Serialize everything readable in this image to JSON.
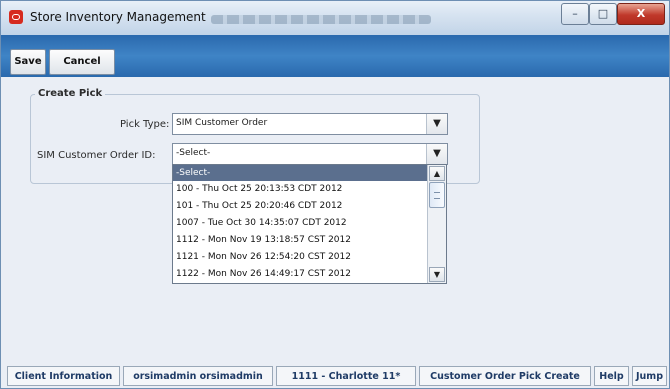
{
  "window": {
    "title": "Store Inventory Management",
    "min_glyph": "–",
    "max_glyph": "□",
    "close_glyph": "X"
  },
  "toolbar": {
    "save_label": "Save",
    "cancel_label": "Cancel"
  },
  "form": {
    "section_title": "Create Pick",
    "pick_type_label": "Pick Type:",
    "pick_type_value": "SIM Customer Order",
    "order_id_label": "SIM Customer Order ID:",
    "order_id_value": "-Select-",
    "dropdown_options": [
      "-Select-",
      "100 - Thu Oct 25 20:13:53 CDT 2012",
      "101 - Thu Oct 25 20:20:46 CDT 2012",
      "1007 - Tue Oct 30 14:35:07 CDT 2012",
      "1112 - Mon Nov 19 13:18:57 CST 2012",
      "1121 - Mon Nov 26 12:54:20 CST 2012",
      "1122 - Mon Nov 26 14:49:17 CST 2012"
    ],
    "selected_option_index": 0
  },
  "status_bar": {
    "items": [
      "Client Information",
      "orsimadmin orsimadmin",
      "1111 - Charlotte 11*",
      "Customer Order Pick Create",
      "Help",
      "Jump"
    ]
  },
  "icons": {
    "combo_arrow": "dropdown-arrow-icon",
    "scroll_up": "scroll-up-icon",
    "scroll_down": "scroll-down-icon"
  },
  "colors": {
    "toolbar": "#3a7bbd",
    "selection": "#5b6f8e",
    "status_text": "#1f3b66",
    "close_button": "#c0392b"
  }
}
